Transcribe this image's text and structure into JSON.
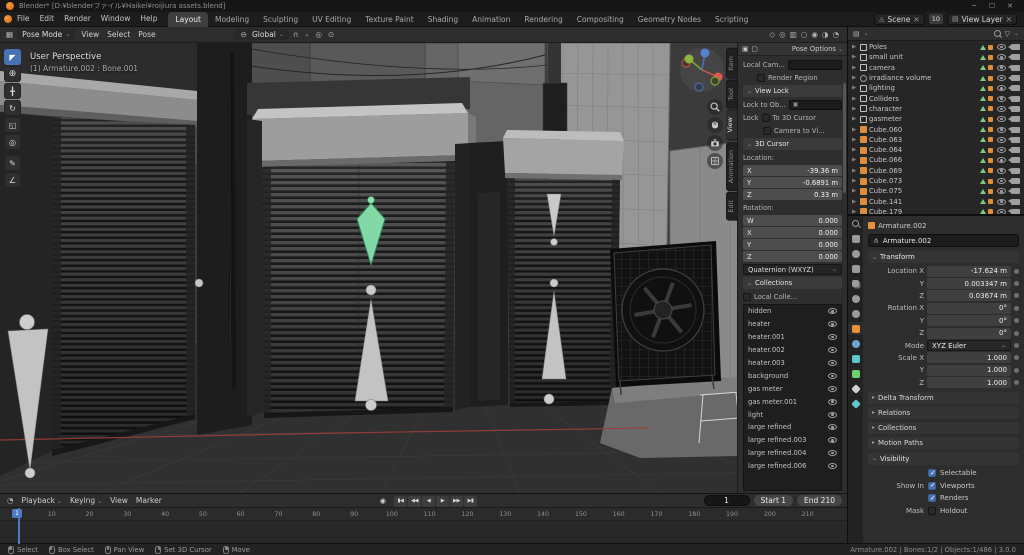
{
  "titlebar": {
    "title": "Blender* [D:¥blenderファイル¥Haikei¥roijiura assets.blend]",
    "minimize": "─",
    "maximize": "☐",
    "close": "✕"
  },
  "topbar": {
    "menus": [
      "File",
      "Edit",
      "Render",
      "Window",
      "Help"
    ],
    "workspaces": [
      {
        "label": "Layout",
        "active": "true"
      },
      {
        "label": "Modeling",
        "active": "false"
      },
      {
        "label": "Sculpting",
        "active": "false"
      },
      {
        "label": "UV Editing",
        "active": "false"
      },
      {
        "label": "Texture Paint",
        "active": "false"
      },
      {
        "label": "Shading",
        "active": "false"
      },
      {
        "label": "Animation",
        "active": "false"
      },
      {
        "label": "Rendering",
        "active": "false"
      },
      {
        "label": "Compositing",
        "active": "false"
      },
      {
        "label": "Geometry Nodes",
        "active": "false"
      },
      {
        "label": "Scripting",
        "active": "false"
      }
    ],
    "scene": {
      "label": "Scene",
      "unlink": "✕"
    },
    "view_layer": {
      "label": "View Layer",
      "users": "10",
      "unlink": "✕"
    }
  },
  "viewport": {
    "header": {
      "mode": "Pose Mode",
      "menus": [
        "View",
        "Select",
        "Pose"
      ],
      "orientation": "Global",
      "tool_settings_label": "Pose Options"
    },
    "overlay": {
      "line1": "User Perspective",
      "line2": "(1) Armature.002 : Bone.001"
    },
    "tools": [
      {
        "id": "select-box",
        "active": "true"
      },
      {
        "id": "cursor",
        "active": "false"
      },
      {
        "id": "move",
        "active": "false"
      },
      {
        "id": "rotate",
        "active": "false"
      },
      {
        "id": "scale",
        "active": "false"
      },
      {
        "id": "transform",
        "active": "false"
      },
      {
        "id": "annotate",
        "active": "false"
      },
      {
        "id": "measure",
        "active": "false"
      }
    ]
  },
  "sidebar": {
    "tabs": [
      {
        "label": "Item",
        "active": "false"
      },
      {
        "label": "Tool",
        "active": "false"
      },
      {
        "label": "View",
        "active": "true"
      },
      {
        "label": "Animation",
        "active": "false"
      },
      {
        "label": "Edit",
        "active": "false"
      }
    ],
    "view": {
      "local_camera": "Local Cam...",
      "render_region": "Render Region"
    },
    "view_lock": {
      "title": "View Lock",
      "lock_to_object": "Lock to Ob...",
      "lock": "Lock",
      "to_3d_cursor": "To 3D Cursor",
      "camera_to_view": "Camera to Vi..."
    },
    "cursor": {
      "title": "3D Cursor",
      "location_label": "Location:",
      "location": [
        {
          "axis": "X",
          "value": "-39.36 m"
        },
        {
          "axis": "Y",
          "value": "-0.6891 m"
        },
        {
          "axis": "Z",
          "value": "0.33 m"
        }
      ],
      "rotation_label": "Rotation:",
      "rotation": [
        {
          "axis": "W",
          "value": "0.000"
        },
        {
          "axis": "X",
          "value": "0.000"
        },
        {
          "axis": "Y",
          "value": "0.000"
        },
        {
          "axis": "Z",
          "value": "0.000"
        }
      ],
      "rotation_mode": "Quaternion (WXYZ)"
    },
    "collections": {
      "title": "Collections",
      "local_collection": "Local Colle...",
      "items": [
        "hidden",
        "heater",
        "heater.001",
        "heater.002",
        "heater.003",
        "background",
        "gas meter",
        "gas meter.001",
        "light",
        "large refined",
        "large refined.003",
        "large refined.004",
        "large refined.006"
      ]
    }
  },
  "outliner": {
    "rows": [
      {
        "name": "Poles",
        "type": "collection"
      },
      {
        "name": "small unit",
        "type": "collection"
      },
      {
        "name": "camera",
        "type": "collection"
      },
      {
        "name": "irradiance volume",
        "type": "lightprobe"
      },
      {
        "name": "lighting",
        "type": "collection"
      },
      {
        "name": "Colliders",
        "type": "collection"
      },
      {
        "name": "character",
        "type": "collection"
      },
      {
        "name": "gasmeter",
        "type": "collection"
      },
      {
        "name": "Cube.060",
        "type": "mesh"
      },
      {
        "name": "Cube.063",
        "type": "mesh"
      },
      {
        "name": "Cube.064",
        "type": "mesh"
      },
      {
        "name": "Cube.066",
        "type": "mesh"
      },
      {
        "name": "Cube.069",
        "type": "mesh"
      },
      {
        "name": "Cube.073",
        "type": "mesh"
      },
      {
        "name": "Cube.075",
        "type": "mesh"
      },
      {
        "name": "Cube.141",
        "type": "mesh"
      },
      {
        "name": "Cube.179",
        "type": "mesh"
      }
    ]
  },
  "properties": {
    "tabs": [
      {
        "id": "tool",
        "active": "false"
      },
      {
        "id": "render",
        "active": "false"
      },
      {
        "id": "output",
        "active": "false"
      },
      {
        "id": "view-layer",
        "active": "false"
      },
      {
        "id": "scene",
        "active": "false"
      },
      {
        "id": "world",
        "active": "false"
      },
      {
        "id": "object",
        "active": "true"
      },
      {
        "id": "physics",
        "active": "false"
      },
      {
        "id": "constraints",
        "active": "false"
      },
      {
        "id": "object-data",
        "active": "false"
      },
      {
        "id": "bone",
        "active": "false"
      },
      {
        "id": "bone-constraint",
        "active": "false"
      }
    ],
    "breadcrumb": "Armature.002",
    "name": "Armature.002",
    "transform": {
      "title": "Transform",
      "rows": [
        {
          "label": "Location X",
          "value": "-17.624 m",
          "kind": "number"
        },
        {
          "label": "Y",
          "value": "0.003347 m",
          "kind": "number"
        },
        {
          "label": "Z",
          "value": "0.03674 m",
          "kind": "number"
        },
        {
          "label": "Rotation X",
          "value": "0°",
          "kind": "number"
        },
        {
          "label": "Y",
          "value": "0°",
          "kind": "number"
        },
        {
          "label": "Z",
          "value": "0°",
          "kind": "number"
        },
        {
          "label": "Mode",
          "value": "XYZ Euler",
          "kind": "menu"
        },
        {
          "label": "Scale X",
          "value": "1.000",
          "kind": "number"
        },
        {
          "label": "Y",
          "value": "1.000",
          "kind": "number"
        },
        {
          "label": "Z",
          "value": "1.000",
          "kind": "number"
        }
      ]
    },
    "collapsed_sections": [
      "Delta Transform",
      "Relations",
      "Collections",
      "Motion Paths"
    ],
    "visibility": {
      "title": "Visibility",
      "selectable": {
        "label": "Selectable",
        "checked": "true"
      },
      "show_in": "Show In",
      "viewports": {
        "label": "Viewports",
        "checked": "true"
      },
      "renders": {
        "label": "Renders",
        "checked": "true"
      },
      "mask": "Mask",
      "holdout": {
        "label": "Holdout",
        "checked": "false"
      }
    }
  },
  "timeline": {
    "menus": [
      {
        "label": "Playback",
        "caret": "true"
      },
      {
        "label": "Keying",
        "caret": "true"
      },
      {
        "label": "View",
        "caret": "false"
      },
      {
        "label": "Marker",
        "caret": "false"
      }
    ],
    "transport": [
      {
        "id": "auto-key",
        "glyph": "◉"
      },
      {
        "id": "jump-to-start",
        "glyph": "▮◀"
      },
      {
        "id": "previous-keyframe",
        "glyph": "◀◀"
      },
      {
        "id": "play-reverse",
        "glyph": "◀"
      },
      {
        "id": "play",
        "glyph": "▶"
      },
      {
        "id": "next-keyframe",
        "glyph": "▶▶"
      },
      {
        "id": "jump-to-end",
        "glyph": "▶▮"
      }
    ],
    "current_frame": "1",
    "start": "Start 1",
    "end": "End 210",
    "playhead": "1",
    "ticks": [
      "0",
      "10",
      "20",
      "30",
      "40",
      "50",
      "60",
      "70",
      "80",
      "90",
      "100",
      "110",
      "120",
      "130",
      "140",
      "150",
      "160",
      "170",
      "180",
      "190",
      "200",
      "210"
    ]
  },
  "statusbar": {
    "hints": [
      {
        "label": "Select",
        "mouse": "left"
      },
      {
        "label": "Box Select",
        "mouse": "left"
      },
      {
        "label": "Pan View",
        "mouse": "middle"
      },
      {
        "label": "Set 3D Cursor",
        "mouse": "right"
      },
      {
        "label": "Move",
        "mouse": "right"
      }
    ],
    "info": "Armature.002  |  Bones:1/2  |  Objects:1/486  |  3.0.0"
  }
}
